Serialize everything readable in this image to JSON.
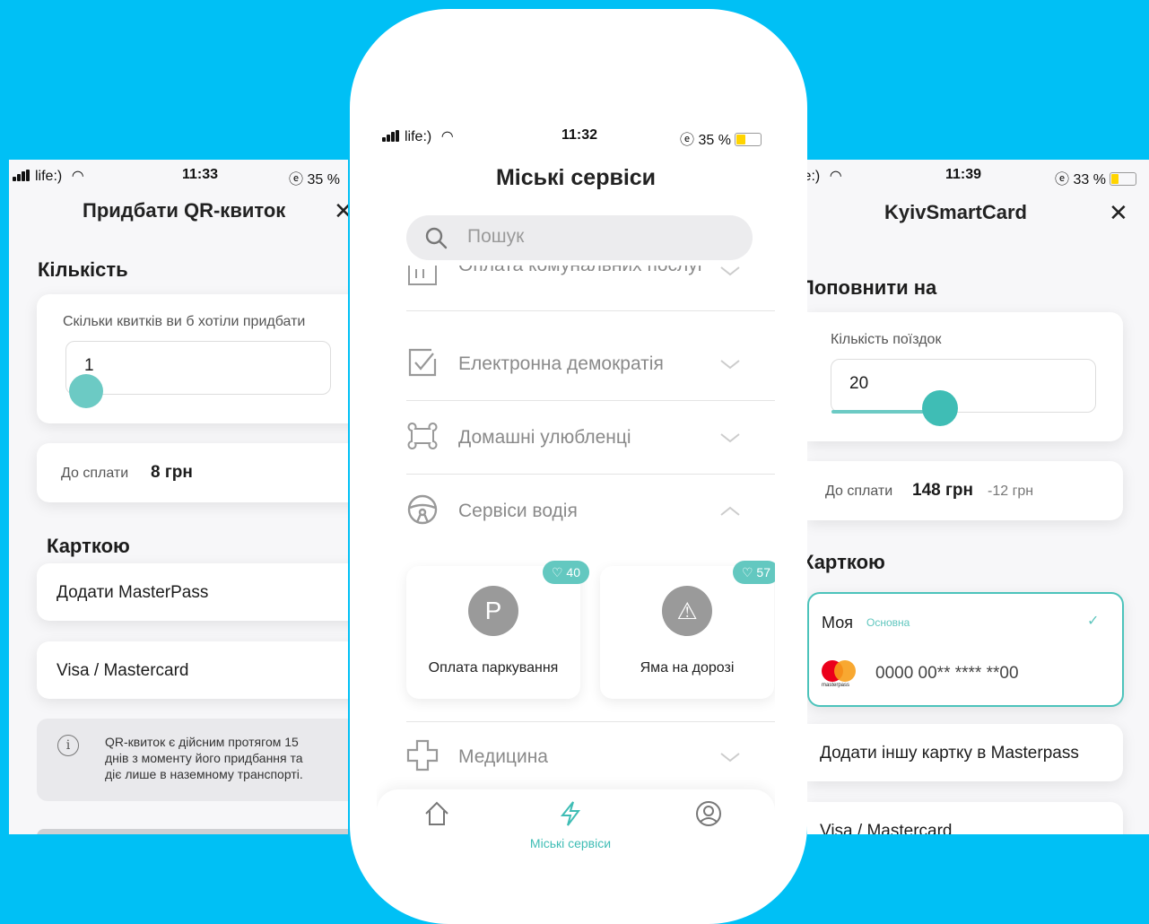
{
  "colors": {
    "background": "#00c0f5",
    "accent": "#63c8c0",
    "battery_low": "#ffd400"
  },
  "left": {
    "status": {
      "carrier": "life:)",
      "time": "11:33",
      "battery": "35 %"
    },
    "title": "Придбати QR-квиток",
    "close_icon": "close-icon",
    "quantity_heading": "Кількість",
    "quantity_question": "Скільки квитків ви б хотіли придбати",
    "quantity_value": "1",
    "slider_level": 0,
    "pay_label": "До сплати",
    "pay_amount": "8 грн",
    "card_heading": "Карткою",
    "option_masterpass": "Додати MasterPass",
    "option_visa": "Visa / Mastercard",
    "info_text_1": "QR-квиток є дійсним протягом 15",
    "info_text_2": "днів з моменту його придбання та",
    "info_text_3": "діє лише в наземному транспорті."
  },
  "center": {
    "status": {
      "carrier": "life:)",
      "time": "11:32",
      "battery": "35 %"
    },
    "title": "Міські сервіси",
    "search_placeholder": "Пошук",
    "rows": [
      {
        "label": "Оплата комунальних послуг",
        "icon": "building-icon"
      },
      {
        "label": "Електронна демократія",
        "icon": "checkbox-icon"
      },
      {
        "label": "Домашні улюбленці",
        "icon": "bone-icon"
      },
      {
        "label": "Сервіси водія",
        "icon": "steering-wheel-icon"
      },
      {
        "label": "Медицина",
        "icon": "medical-cross-icon"
      }
    ],
    "tiles": [
      {
        "label": "Оплата паркування",
        "likes": "40",
        "symbol": "P",
        "icon": "parking-icon"
      },
      {
        "label": "Яма на дорозі",
        "likes": "57",
        "symbol": "⚠",
        "icon": "warning-icon"
      }
    ],
    "tabs": [
      {
        "label": "",
        "icon": "home-icon"
      },
      {
        "label": "Міські сервіси",
        "icon": "lightning-icon"
      },
      {
        "label": "",
        "icon": "profile-icon"
      }
    ]
  },
  "right": {
    "status": {
      "carrier": "life:)",
      "time": "11:39",
      "battery": "33 %"
    },
    "title": "KyivSmartCard",
    "topup_heading": "Поповнити на",
    "trips_label": "Кількість поїздок",
    "trips_value": "20",
    "slider_level": 0.4,
    "pay_label": "До сплати",
    "pay_amount": "148 грн",
    "discount": "-12 грн",
    "card_heading": "Карткою",
    "card_name": "Моя",
    "card_tag": "Основна",
    "card_number": "0000 00** **** **00",
    "card_brand": "masterpass",
    "add_card": "Додати іншу картку в Masterpass",
    "option_visa": "Visa / Mastercard"
  }
}
